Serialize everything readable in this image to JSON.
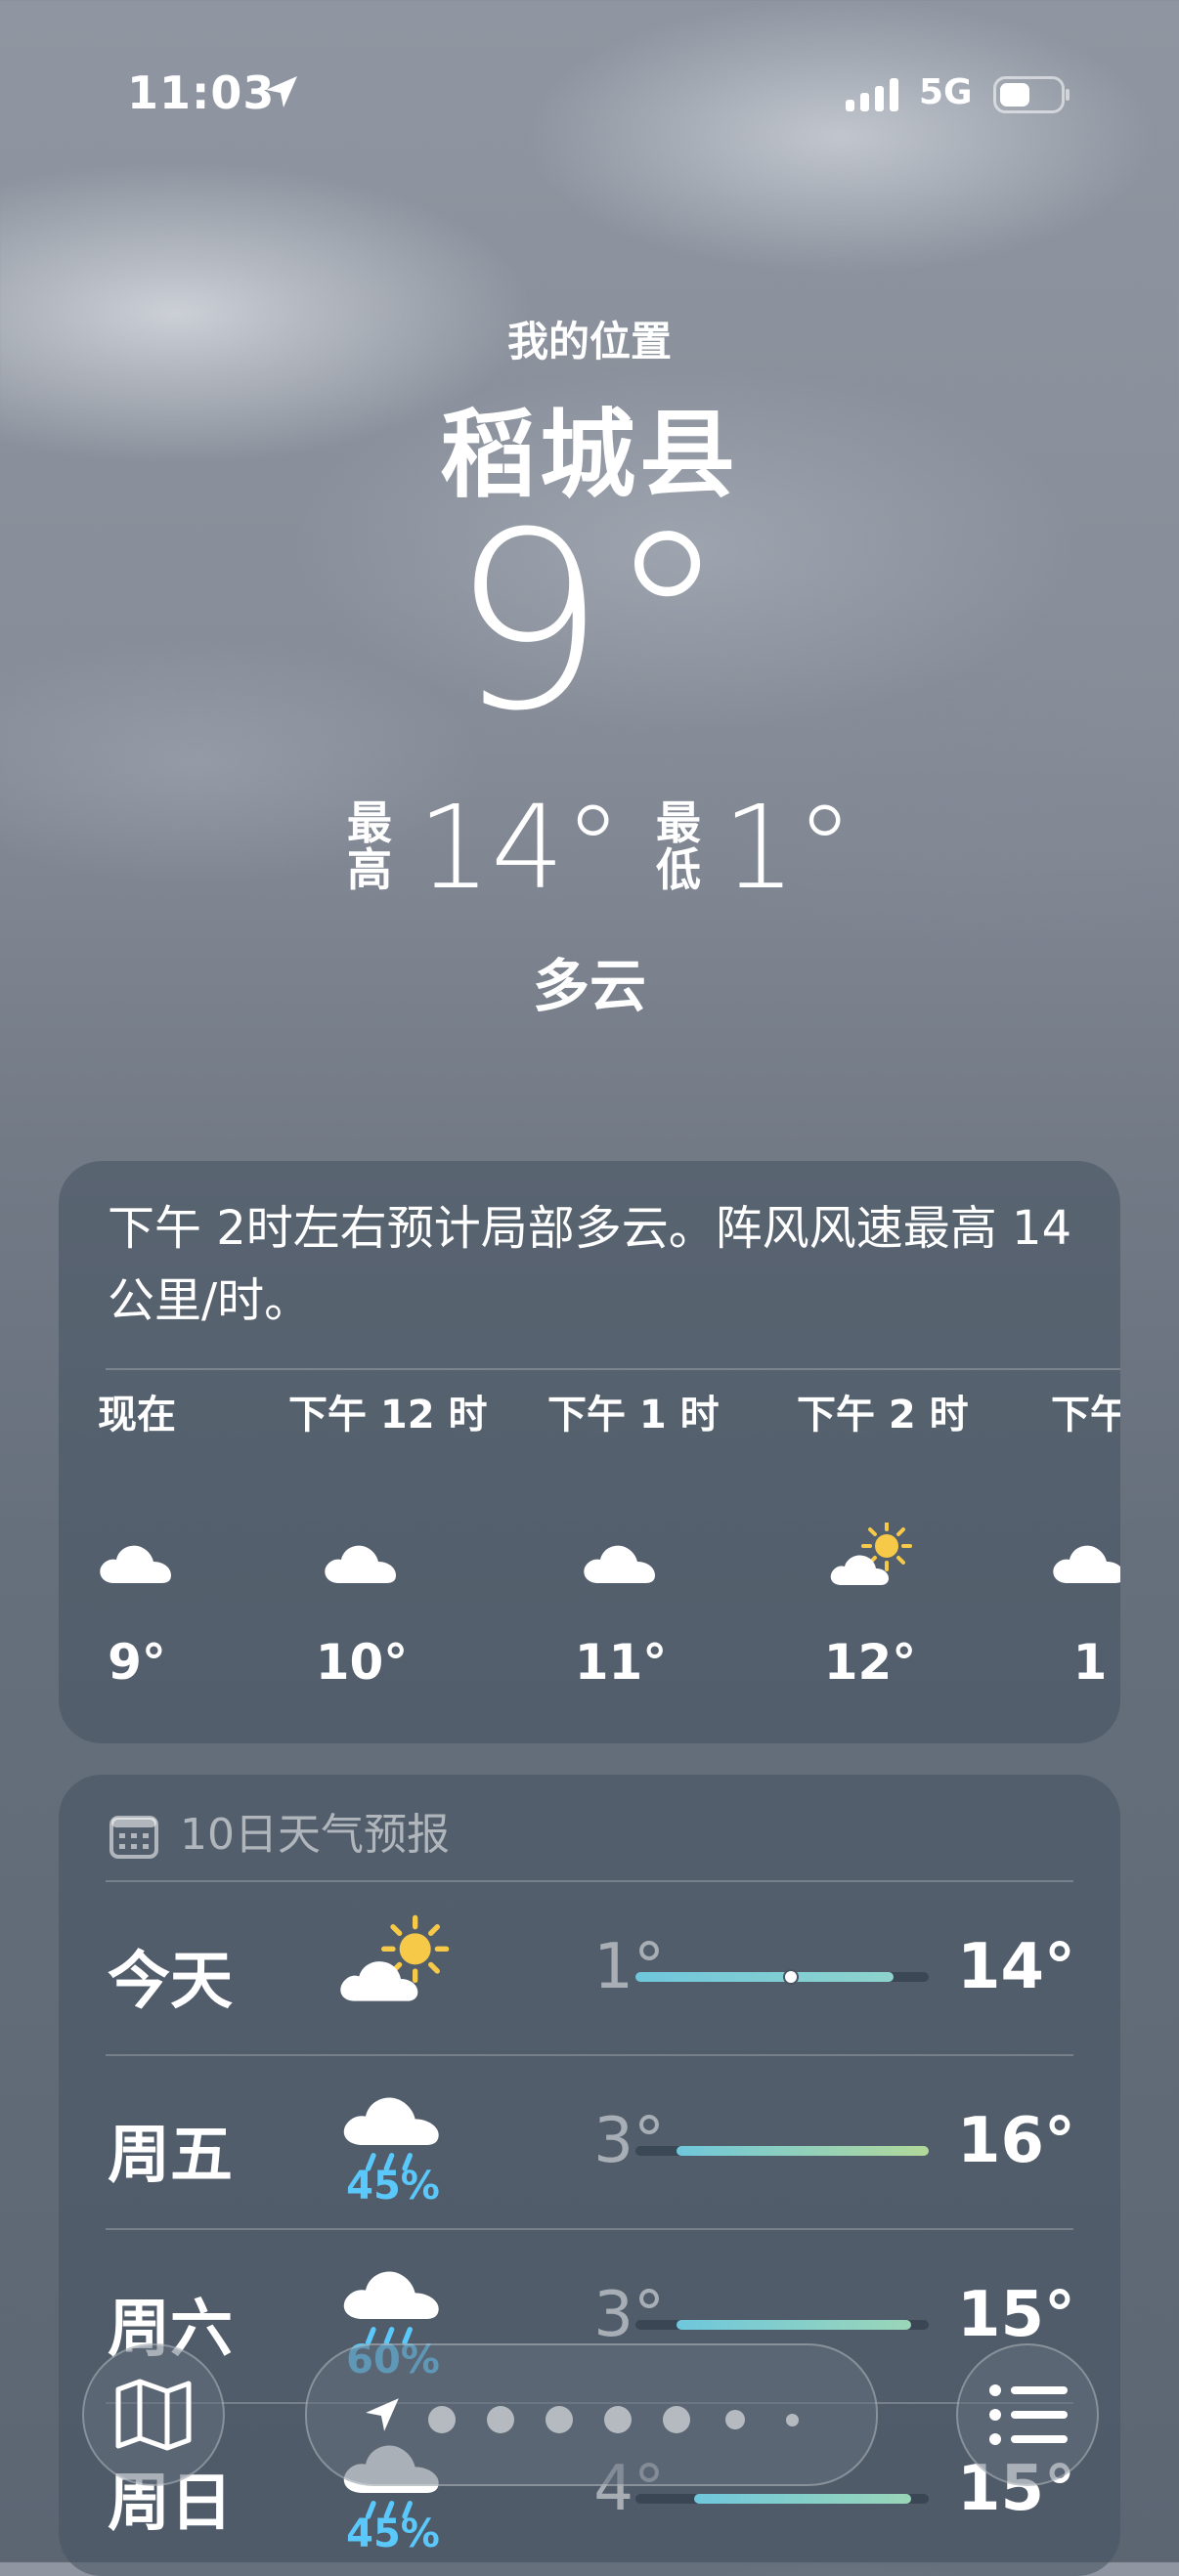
{
  "status": {
    "time": "11:03",
    "network": "5G"
  },
  "location": {
    "label": "我的位置",
    "city": "稻城县"
  },
  "current": {
    "temp": "9°",
    "high_label_1": "最",
    "high_label_2": "高",
    "high": "14°",
    "low_label_1": "最",
    "low_label_2": "低",
    "low": "1°",
    "condition": "多云"
  },
  "hourly_card": {
    "summary": "下午 2时左右预计局部多云。阵风风速最高 14 公里/时。",
    "hours": [
      {
        "label": "现在",
        "icon": "cloud-icon",
        "temp": "9°"
      },
      {
        "label": "下午 12 时",
        "icon": "cloud-icon",
        "temp": "10°"
      },
      {
        "label": "下午 1 时",
        "icon": "cloud-icon",
        "temp": "11°"
      },
      {
        "label": "下午 2 时",
        "icon": "partly-sunny-icon",
        "temp": "12°"
      },
      {
        "label": "下午",
        "icon": "cloud-icon",
        "temp": "1"
      }
    ]
  },
  "forecast_card": {
    "title": "10日天气预报",
    "days": [
      {
        "day": "今天",
        "icon": "partly-sunny-icon",
        "precip": "",
        "low": "1°",
        "high": "14°",
        "bar_start": 0.0,
        "bar_end": 0.88,
        "current": 0.53,
        "bar_colors": [
          "#6fc7dc",
          "#8ed3cc"
        ]
      },
      {
        "day": "周五",
        "icon": "rain-cloud-icon",
        "precip": "45%",
        "low": "3°",
        "high": "16°",
        "bar_start": 0.14,
        "bar_end": 1.0,
        "bar_colors": [
          "#6fc7dc",
          "#b2d89a"
        ]
      },
      {
        "day": "周六",
        "icon": "rain-cloud-icon",
        "precip": "60%",
        "low": "3°",
        "high": "15°",
        "bar_start": 0.14,
        "bar_end": 0.94,
        "bar_colors": [
          "#6fc7dc",
          "#9ad6b8"
        ]
      },
      {
        "day": "周日",
        "icon": "rain-cloud-icon",
        "precip": "45%",
        "low": "4°",
        "high": "15°",
        "bar_start": 0.2,
        "bar_end": 0.94,
        "bar_colors": [
          "#6fc7dc",
          "#9ad6b8"
        ]
      }
    ]
  },
  "toolbar": {
    "map_icon": "map-icon",
    "list_icon": "list-icon",
    "page_count": 7
  }
}
